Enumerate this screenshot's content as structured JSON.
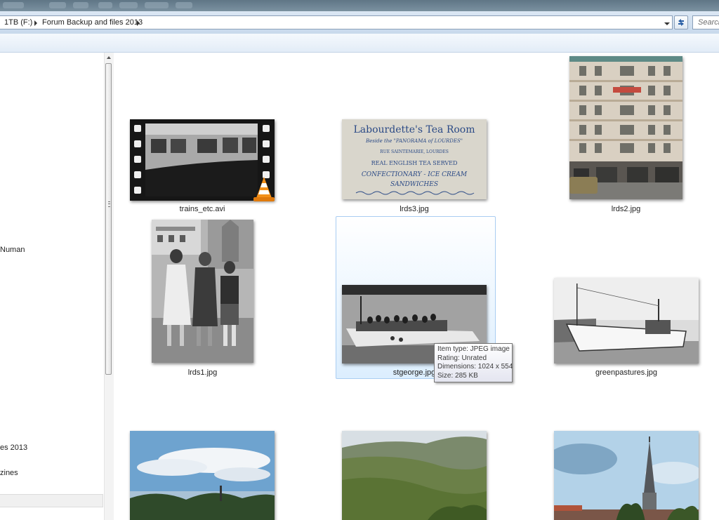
{
  "address_bar": {
    "crumbs": [
      "1TB (F:)",
      "Forum Backup and files 2013"
    ],
    "search_placeholder": "Search"
  },
  "nav_pane": {
    "items": [
      "Numan",
      "es 2013",
      "zines"
    ],
    "selected_index": 1
  },
  "files": [
    {
      "name": "trains_etc.avi",
      "type": "video"
    },
    {
      "name": "lrds3.jpg",
      "type": "image"
    },
    {
      "name": "lrds2.jpg",
      "type": "image"
    },
    {
      "name": "lrds1.jpg",
      "type": "image"
    },
    {
      "name": "stgeorge.jpg",
      "type": "image",
      "selected": true
    },
    {
      "name": "greenpastures.jpg",
      "type": "image"
    },
    {
      "name": "",
      "type": "image"
    },
    {
      "name": "",
      "type": "image"
    },
    {
      "name": "",
      "type": "image"
    }
  ],
  "thumb_text": {
    "tearoom_title": "Labourdette's Tea Room",
    "tearoom_line1": "Beside the \"PANORAMA of LOURDES\"",
    "tearoom_line2": "RUE SAINTEMARIE, LOURDES",
    "tearoom_line3": "REAL ENGLISH TEA SERVED",
    "tearoom_line4": "CONFECTIONARY - ICE CREAM",
    "tearoom_line5": "SANDWICHES"
  },
  "tooltip": {
    "item_type": "Item type: JPEG image",
    "rating": "Rating: Unrated",
    "dimensions": "Dimensions: 1024 x 554",
    "size": "Size: 285 KB"
  },
  "colors": {
    "selection_border": "#a9cdf2",
    "vlc_orange": "#f39019"
  }
}
